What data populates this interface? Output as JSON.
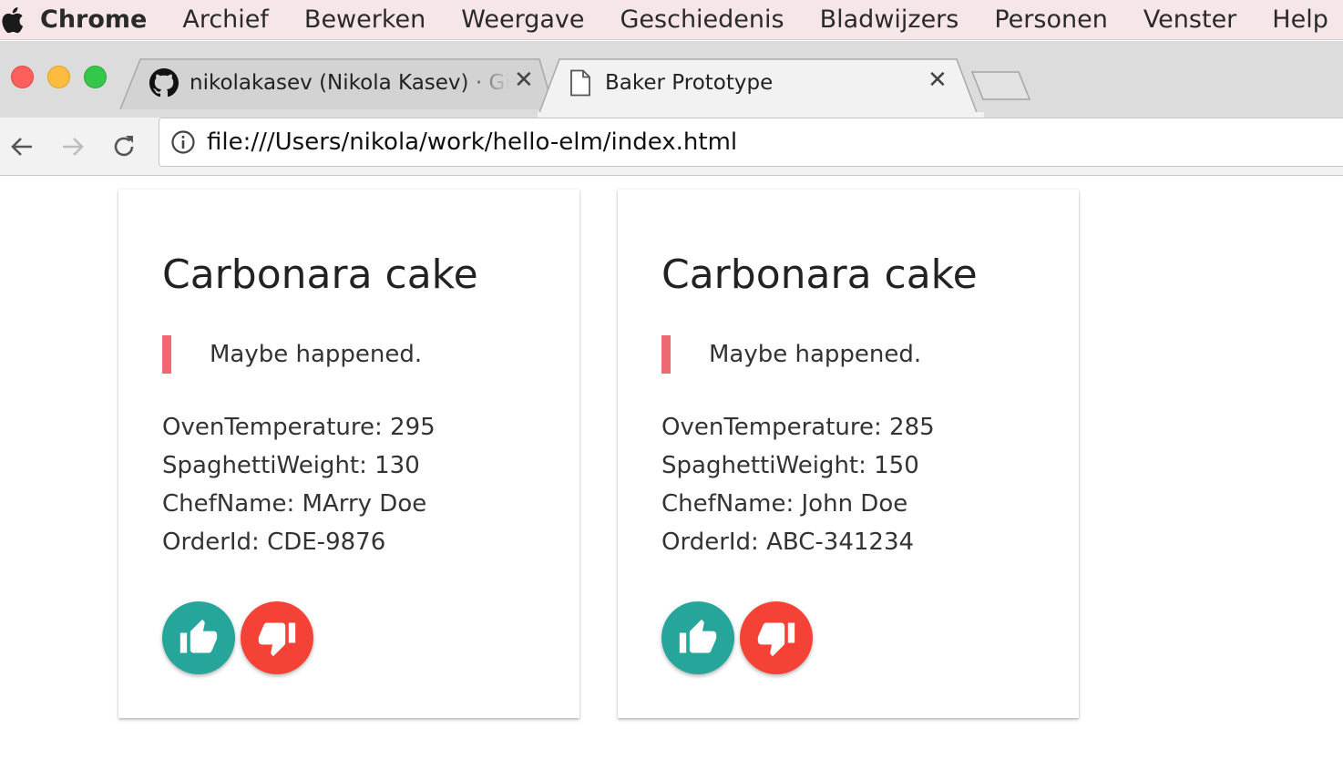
{
  "menubar": {
    "app_name": "Chrome",
    "items": [
      "Archief",
      "Bewerken",
      "Weergave",
      "Geschiedenis",
      "Bladwijzers",
      "Personen",
      "Venster",
      "Help"
    ]
  },
  "tabs": [
    {
      "title": "nikolakasev (Nikola Kasev) · GitHub",
      "icon": "github-icon",
      "active": false
    },
    {
      "title": "Baker Prototype",
      "icon": "document-icon",
      "active": true
    }
  ],
  "address_bar": {
    "url": "file:///Users/nikola/work/hello-elm/index.html"
  },
  "colors": {
    "approve": "#26a69a",
    "reject": "#f44336",
    "status_bar": "#ee6a73"
  },
  "cards": [
    {
      "title": "Carbonara cake",
      "status": "Maybe happened.",
      "props": [
        "OvenTemperature: 295",
        "SpaghettiWeight: 130",
        "ChefName: MArry Doe",
        "OrderId: CDE-9876"
      ]
    },
    {
      "title": "Carbonara cake",
      "status": "Maybe happened.",
      "props": [
        "OvenTemperature: 285",
        "SpaghettiWeight: 150",
        "ChefName: John Doe",
        "OrderId: ABC-341234"
      ]
    }
  ]
}
